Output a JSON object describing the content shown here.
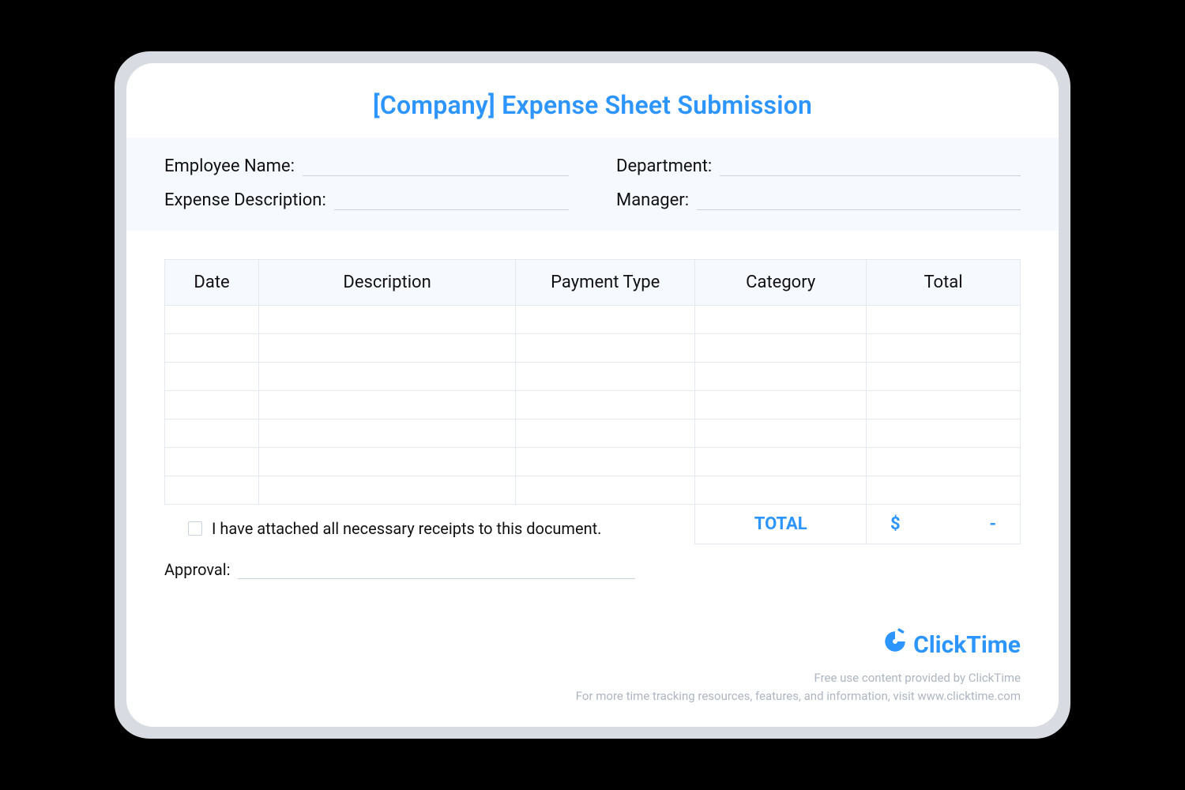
{
  "title": "[Company] Expense Sheet Submission",
  "fields": {
    "employee_name": "Employee Name:",
    "department": "Department:",
    "expense_description": "Expense Description:",
    "manager": "Manager:"
  },
  "columns": {
    "date": "Date",
    "description": "Description",
    "payment_type": "Payment Type",
    "category": "Category",
    "total": "Total"
  },
  "rows": 7,
  "total_label": "TOTAL",
  "total_currency": "$",
  "total_value": "-",
  "receipt_checkbox_label": "I have attached all necessary receipts to this document.",
  "approval_label": "Approval:",
  "brand": "ClickTime",
  "credit_line1": "Free use content provided by ClickTime",
  "credit_line2": "For more time tracking resources, features, and information, visit www.clicktime.com"
}
